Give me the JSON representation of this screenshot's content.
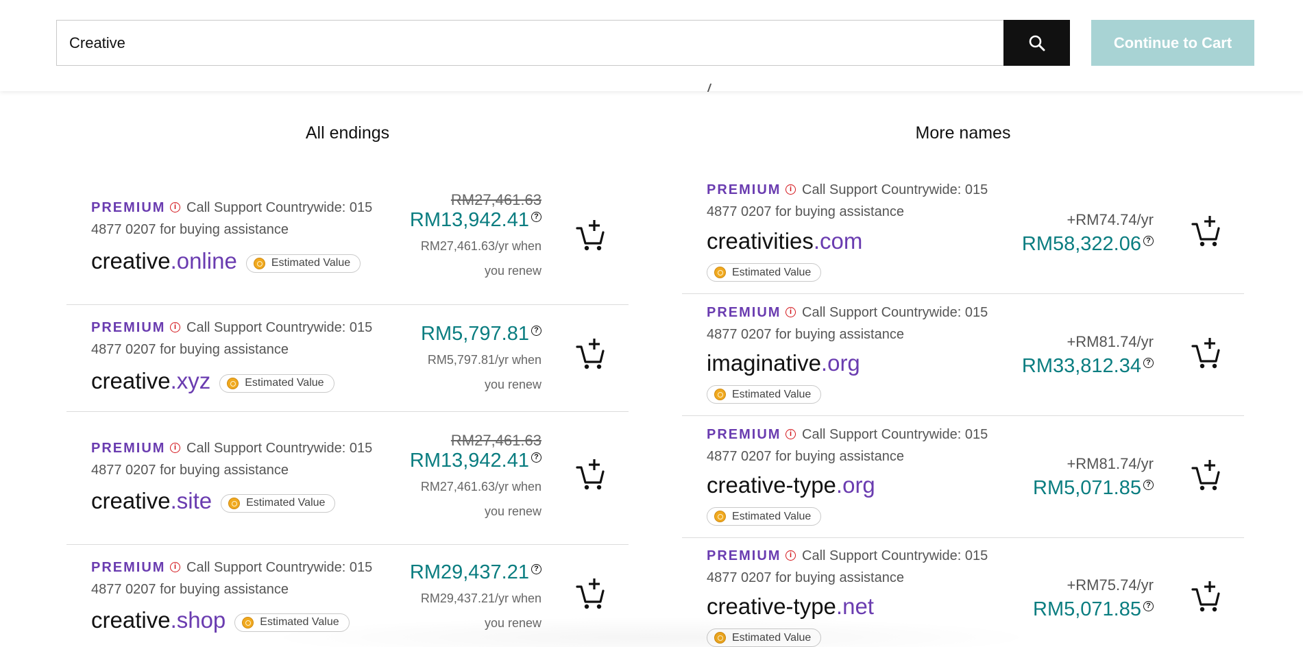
{
  "search": {
    "value": "Creative"
  },
  "header": {
    "continue_label": "Continue to Cart"
  },
  "columns": {
    "left_title": "All endings",
    "right_title": "More names"
  },
  "labels": {
    "premium": "PREMIUM",
    "support": "Call Support Countrywide: 015 4877 0207 for buying assistance",
    "estimated_value": "Estimated Value"
  },
  "icons": {
    "search": "search-icon",
    "info": "info-icon",
    "help": "question-circle-icon",
    "coin": "coin-icon",
    "add_cart": "add-to-cart-icon"
  },
  "colors": {
    "premium": "#6a3cb0",
    "price": "#0a7d80",
    "info": "#d3141a",
    "continue_button": "#a8d3d4",
    "search_button": "#111111"
  },
  "left_results": [
    {
      "name": "creative",
      "tld": ".online",
      "old_price": "RM27,461.63",
      "price": "RM13,942.41",
      "renew": "RM27,461.63/yr when",
      "renew2": "you renew"
    },
    {
      "name": "creative",
      "tld": ".xyz",
      "old_price": "",
      "price": "RM5,797.81",
      "renew": "RM5,797.81/yr when",
      "renew2": "you renew"
    },
    {
      "name": "creative",
      "tld": ".site",
      "old_price": "RM27,461.63",
      "price": "RM13,942.41",
      "renew": "RM27,461.63/yr when",
      "renew2": "you renew"
    },
    {
      "name": "creative",
      "tld": ".shop",
      "old_price": "",
      "price": "RM29,437.21",
      "renew": "RM29,437.21/yr when",
      "renew2": "you renew"
    }
  ],
  "right_results": [
    {
      "name": "creativities",
      "tld": ".com",
      "yearly": "+RM74.74/yr",
      "price": "RM58,322.06"
    },
    {
      "name": "imaginative",
      "tld": ".org",
      "yearly": "+RM81.74/yr",
      "price": "RM33,812.34"
    },
    {
      "name": "creative-type",
      "tld": ".org",
      "yearly": "+RM81.74/yr",
      "price": "RM5,071.85"
    },
    {
      "name": "creative-type",
      "tld": ".net",
      "yearly": "+RM75.74/yr",
      "price": "RM5,071.85"
    }
  ]
}
